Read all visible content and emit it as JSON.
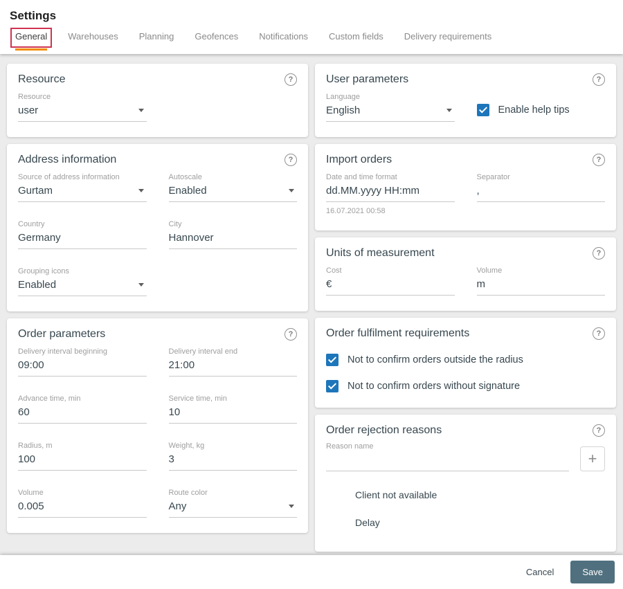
{
  "header": {
    "title": "Settings"
  },
  "tabs": [
    {
      "label": "General",
      "active": true
    },
    {
      "label": "Warehouses",
      "active": false
    },
    {
      "label": "Planning",
      "active": false
    },
    {
      "label": "Geofences",
      "active": false
    },
    {
      "label": "Notifications",
      "active": false
    },
    {
      "label": "Custom fields",
      "active": false
    },
    {
      "label": "Delivery requirements",
      "active": false
    }
  ],
  "icons": {
    "help": "?",
    "add": "+"
  },
  "resource": {
    "title": "Resource",
    "resource_label": "Resource",
    "resource_value": "user"
  },
  "user_parameters": {
    "title": "User parameters",
    "language_label": "Language",
    "language_value": "English",
    "enable_help_tips_label": "Enable help tips",
    "enable_help_tips_checked": true
  },
  "address_information": {
    "title": "Address information",
    "source_label": "Source of address information",
    "source_value": "Gurtam",
    "autoscale_label": "Autoscale",
    "autoscale_value": "Enabled",
    "country_label": "Country",
    "country_value": "Germany",
    "city_label": "City",
    "city_value": "Hannover",
    "grouping_icons_label": "Grouping icons",
    "grouping_icons_value": "Enabled"
  },
  "import_orders": {
    "title": "Import orders",
    "datetime_label": "Date and time format",
    "datetime_value": "dd.MM.yyyy HH:mm",
    "datetime_hint": "16.07.2021 00:58",
    "separator_label": "Separator",
    "separator_value": ","
  },
  "units": {
    "title": "Units of measurement",
    "cost_label": "Cost",
    "cost_value": "€",
    "volume_label": "Volume",
    "volume_value": "m"
  },
  "order_parameters": {
    "title": "Order parameters",
    "fields": [
      {
        "label": "Delivery interval beginning",
        "value": "09:00"
      },
      {
        "label": "Delivery interval end",
        "value": "21:00"
      },
      {
        "label": "Advance time, min",
        "value": "60"
      },
      {
        "label": "Service time, min",
        "value": "10"
      },
      {
        "label": "Radius, m",
        "value": "100"
      },
      {
        "label": "Weight, kg",
        "value": "3"
      },
      {
        "label": "Volume",
        "value": "0.005"
      },
      {
        "label": "Route color",
        "value": "Any"
      }
    ]
  },
  "order_fulfilment": {
    "title": "Order fulfilment requirements",
    "checkboxes": [
      {
        "label": "Not to confirm orders outside the radius",
        "checked": true
      },
      {
        "label": "Not to confirm orders without signature",
        "checked": true
      }
    ]
  },
  "order_rejection": {
    "title": "Order rejection reasons",
    "reason_label": "Reason name",
    "reason_value": "",
    "reasons": [
      "Client not available",
      "Delay"
    ]
  },
  "footer": {
    "cancel": "Cancel",
    "save": "Save"
  },
  "colors": {
    "accent_orange": "#f28b00",
    "annotation_red": "#cf3350",
    "checkbox_blue": "#1d76ba",
    "save_button": "#50707f",
    "background": "#ececec"
  }
}
